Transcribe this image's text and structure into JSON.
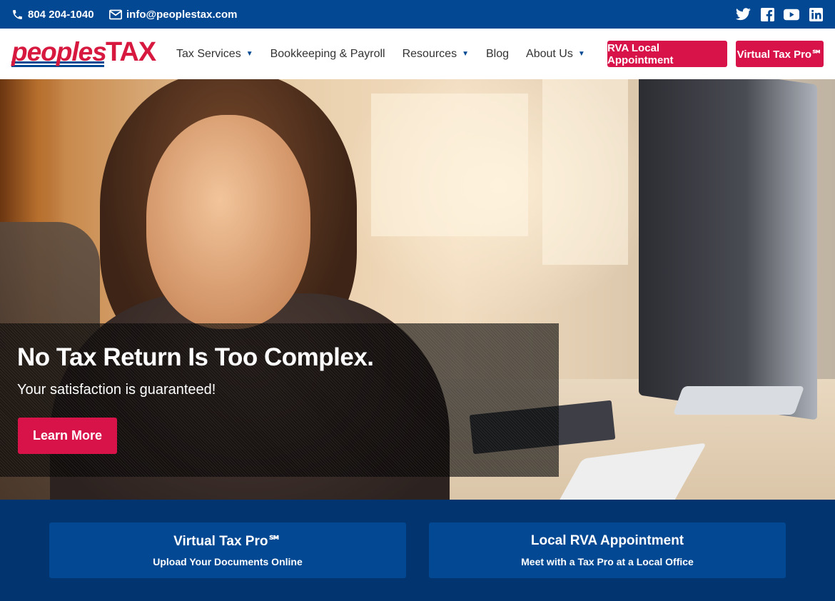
{
  "topbar": {
    "phone": "804 204-1040",
    "email": "info@peoplestax.com",
    "social": [
      "twitter-icon",
      "facebook-icon",
      "youtube-icon",
      "linkedin-icon"
    ],
    "background": "#034892"
  },
  "logo": {
    "word1": "peoples",
    "word2": "TAX",
    "brand_red": "#d7193f",
    "brand_blue": "#034892"
  },
  "nav": {
    "items": [
      {
        "label": "Tax Services",
        "dropdown": true
      },
      {
        "label": "Bookkeeping & Payroll",
        "dropdown": false
      },
      {
        "label": "Resources",
        "dropdown": true
      },
      {
        "label": "Blog",
        "dropdown": false
      },
      {
        "label": "About Us",
        "dropdown": true
      }
    ],
    "buttons": {
      "rva": "RVA Local Appointment",
      "vtp": "Virtual Tax Pro℠"
    },
    "accent": "#d7134a"
  },
  "hero": {
    "headline": "No Tax Return Is Too Complex.",
    "subtitle": "Your satisfaction is guaranteed!",
    "cta": "Learn More"
  },
  "cards": [
    {
      "title": "Virtual Tax Pro℠",
      "desc": "Upload Your Documents Online"
    },
    {
      "title": "Local RVA Appointment",
      "desc": "Meet with a Tax Pro at a Local Office"
    }
  ]
}
